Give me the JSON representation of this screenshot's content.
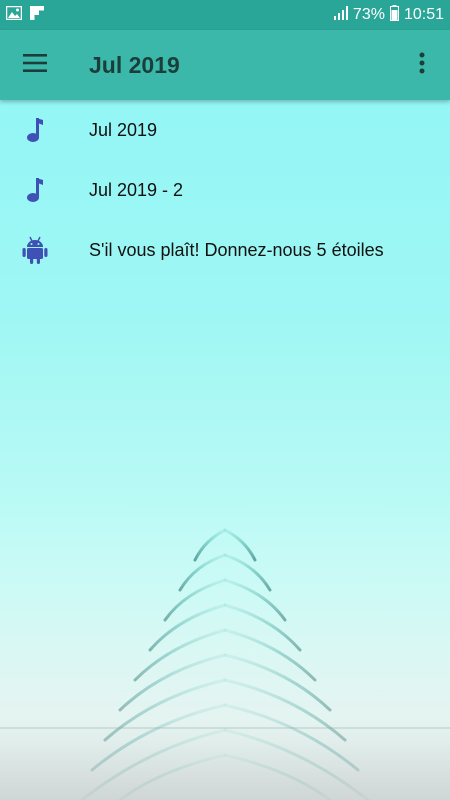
{
  "status_bar": {
    "battery": "73%",
    "time": "10:51"
  },
  "app_bar": {
    "title": "Jul 2019",
    "menu_icon": "hamburger-menu-icon",
    "overflow_icon": "more-vert-icon"
  },
  "list": {
    "items": [
      {
        "label": "Jul 2019",
        "icon": "music-note-icon"
      },
      {
        "label": "Jul 2019 - 2",
        "icon": "music-note-icon"
      },
      {
        "label": "S'il vous plaît! Donnez-nous 5 étoiles",
        "icon": "android-icon"
      }
    ]
  },
  "colors": {
    "status_bar": "#2aa698",
    "app_bar": "#3bb8aa",
    "icon_blue": "#3f51b5"
  }
}
